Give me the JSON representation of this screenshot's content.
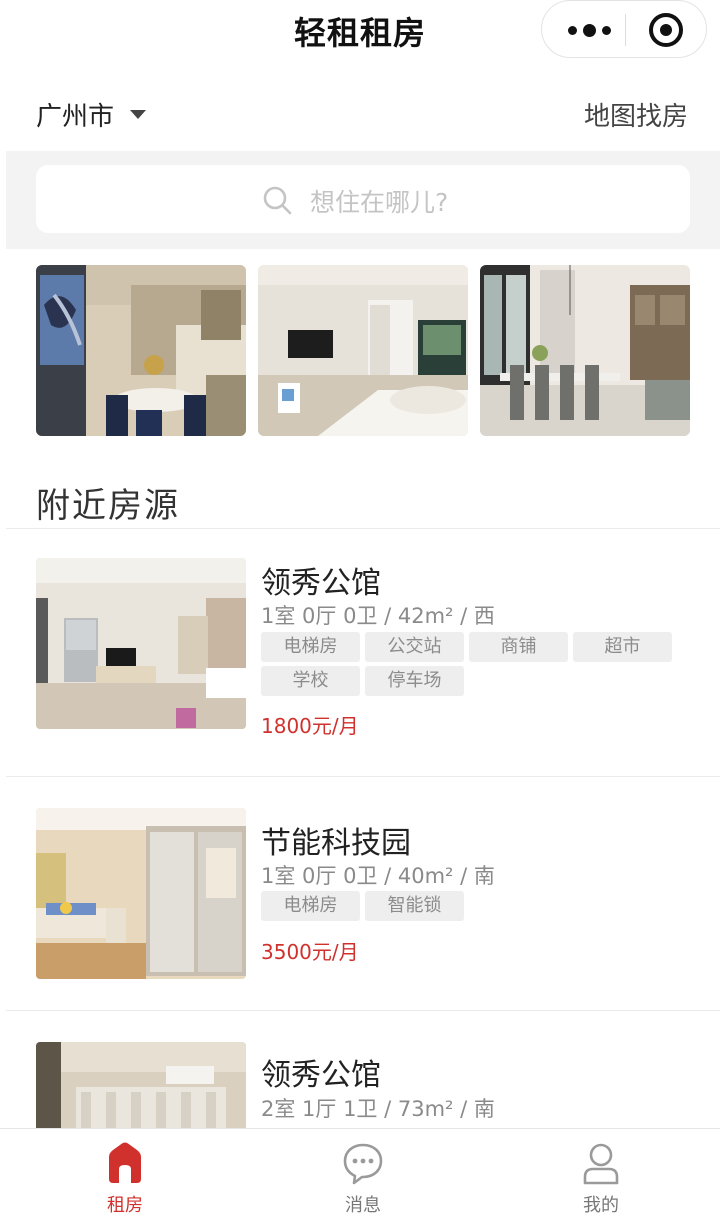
{
  "app": {
    "title": "轻租租房"
  },
  "location": {
    "city": "广州市",
    "map_link": "地图找房"
  },
  "search": {
    "placeholder": "想住在哪儿?"
  },
  "section": {
    "title": "附近房源"
  },
  "listings": [
    {
      "name": "领秀公馆",
      "spec": "1室 0厅 0卫 / 42m² / 西",
      "tags": [
        "电梯房",
        "公交站",
        "商铺",
        "超市",
        "学校",
        "停车场"
      ],
      "price": "1800元/月"
    },
    {
      "name": "节能科技园",
      "spec": "1室 0厅 0卫 / 40m² / 南",
      "tags": [
        "电梯房",
        "智能锁"
      ],
      "price": "3500元/月"
    },
    {
      "name": "领秀公馆",
      "spec": "2室 1厅 1卫 / 73m² / 南",
      "tags": [],
      "price": ""
    }
  ],
  "tabbar": [
    {
      "label": "租房",
      "icon": "home-icon",
      "active": true
    },
    {
      "label": "消息",
      "icon": "chat-bubble-icon",
      "active": false
    },
    {
      "label": "我的",
      "icon": "person-icon",
      "active": false
    }
  ],
  "colors": {
    "accent": "#d0312d",
    "tag_bg": "#eeeeee",
    "search_band": "#f3f3f3"
  }
}
